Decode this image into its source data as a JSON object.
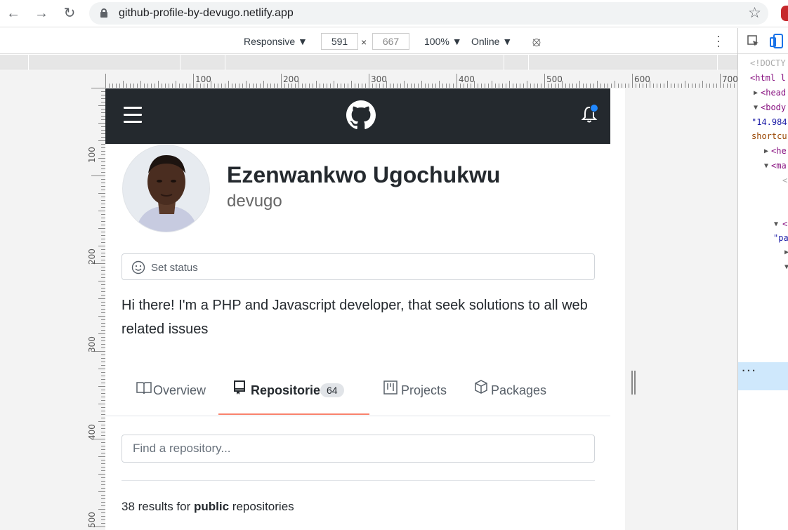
{
  "browser": {
    "url": "github-profile-by-devugo.netlify.app"
  },
  "device_toolbar": {
    "mode": "Responsive ▼",
    "width": "591",
    "height": "667",
    "times": "×",
    "zoom": "100% ▼",
    "network": "Online ▼"
  },
  "rulers": {
    "horizontal": [
      "100",
      "200",
      "300",
      "400",
      "500",
      "600",
      "700"
    ],
    "vertical": [
      "100",
      "200",
      "300",
      "400",
      "500"
    ]
  },
  "profile": {
    "name": "Ezenwankwo Ugochukwu",
    "login": "devugo",
    "status_label": "Set status",
    "bio": "Hi there! I'm a PHP and Javascript developer, that seek solutions to all web related issues"
  },
  "tabs": {
    "overview": "Overview",
    "repositories": "Repositories",
    "repositories_count": "64",
    "projects": "Projects",
    "packages": "Packages"
  },
  "repo_search": {
    "placeholder": "Find a repository..."
  },
  "results": {
    "count_text": "38 results for ",
    "type": "public",
    "suffix": " repositories"
  },
  "devtools": {
    "lines": [
      "<!DOCTY",
      "<html l",
      "<head",
      "<body",
      "\"14.984",
      "shortcu",
      "<he",
      "<ma",
      "<",
      "<",
      "\"pa",
      "..."
    ]
  },
  "colors": {
    "header_bg": "#24292e",
    "tab_underline": "#f9826c",
    "notification_dot": "#2188ff"
  }
}
